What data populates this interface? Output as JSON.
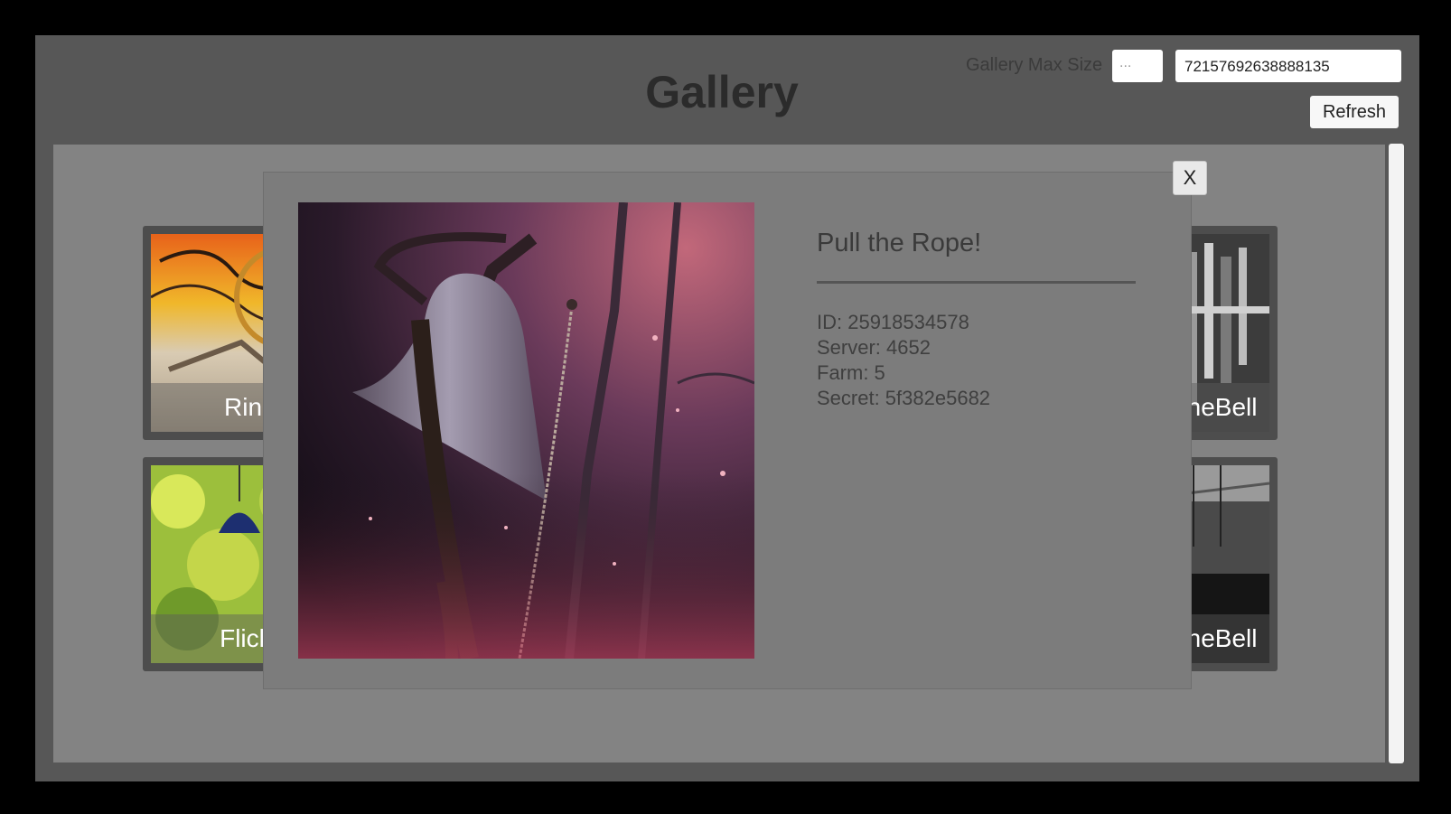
{
  "header": {
    "title": "Gallery",
    "max_size_label": "Gallery Max Size",
    "max_size_placeholder": "...",
    "user_id_value": "72157692638888135",
    "refresh_label": "Refresh"
  },
  "tiles": [
    {
      "caption": "Ring T",
      "image": "orange-bell-abstract"
    },
    {
      "caption": "TheBell",
      "image": "wind-chime-bw"
    },
    {
      "caption": "Flick Fr",
      "image": "blue-bell-greenery"
    },
    {
      "caption": "TheBell",
      "image": "pier-bridge-bw"
    }
  ],
  "modal": {
    "title": "Pull the Rope!",
    "id_line": "ID: 25918534578",
    "server_line": "Server: 4652",
    "farm_line": "Farm: 5",
    "secret_line": "Secret: 5f382e5682",
    "close_label": "X",
    "image": "rusty-bell-with-rope"
  }
}
